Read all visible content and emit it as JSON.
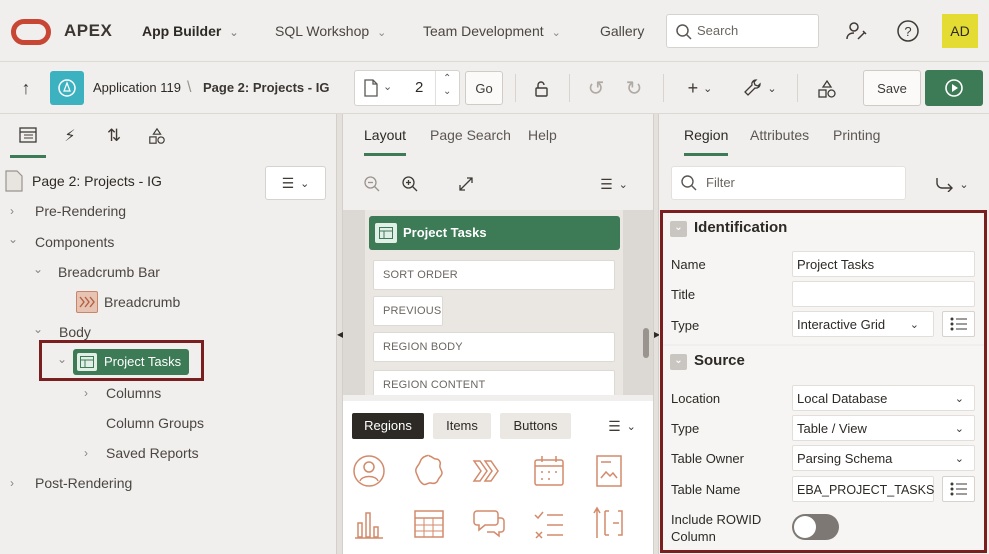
{
  "header": {
    "app_name": "APEX",
    "nav": [
      {
        "label": "App Builder"
      },
      {
        "label": "SQL Workshop"
      },
      {
        "label": "Team Development"
      },
      {
        "label": "Gallery"
      }
    ],
    "search_placeholder": "Search",
    "avatar": "AD"
  },
  "toolbar": {
    "app_label": "Application 119",
    "page_label": "Page 2: Projects - IG",
    "page_number": "2",
    "go_label": "Go",
    "save_label": "Save"
  },
  "tree": {
    "root": "Page 2: Projects - IG",
    "items": [
      {
        "label": "Pre-Rendering"
      },
      {
        "label": "Components"
      },
      {
        "label": "Breadcrumb Bar"
      },
      {
        "label": "Breadcrumb"
      },
      {
        "label": "Body"
      },
      {
        "label": "Project Tasks"
      },
      {
        "label": "Columns"
      },
      {
        "label": "Column Groups"
      },
      {
        "label": "Saved Reports"
      },
      {
        "label": "Post-Rendering"
      }
    ]
  },
  "layout": {
    "tabs": [
      {
        "label": "Layout"
      },
      {
        "label": "Page Search"
      },
      {
        "label": "Help"
      }
    ],
    "region_title": "Project Tasks",
    "positions": [
      "SORT ORDER",
      "PREVIOUS",
      "REGION BODY",
      "REGION CONTENT"
    ],
    "gallery_tabs": [
      {
        "label": "Regions"
      },
      {
        "label": "Items"
      },
      {
        "label": "Buttons"
      }
    ]
  },
  "props": {
    "tabs": [
      {
        "label": "Region"
      },
      {
        "label": "Attributes"
      },
      {
        "label": "Printing"
      }
    ],
    "filter_placeholder": "Filter",
    "identification": {
      "title": "Identification",
      "name_label": "Name",
      "name_value": "Project Tasks",
      "title_label": "Title",
      "title_value": "",
      "type_label": "Type",
      "type_value": "Interactive Grid"
    },
    "source": {
      "title": "Source",
      "location_label": "Location",
      "location_value": "Local Database",
      "type_label": "Type",
      "type_value": "Table / View",
      "owner_label": "Table Owner",
      "owner_value": "Parsing Schema",
      "table_label": "Table Name",
      "table_value": "EBA_PROJECT_TASKS",
      "rowid_label_1": "Include ROWID",
      "rowid_label_2": "Column"
    }
  },
  "colors": {
    "brand_red": "#c74634",
    "accent_green": "#3d7a56",
    "highlight_border": "#7a1f1f",
    "avatar_bg": "#e5dc33"
  }
}
